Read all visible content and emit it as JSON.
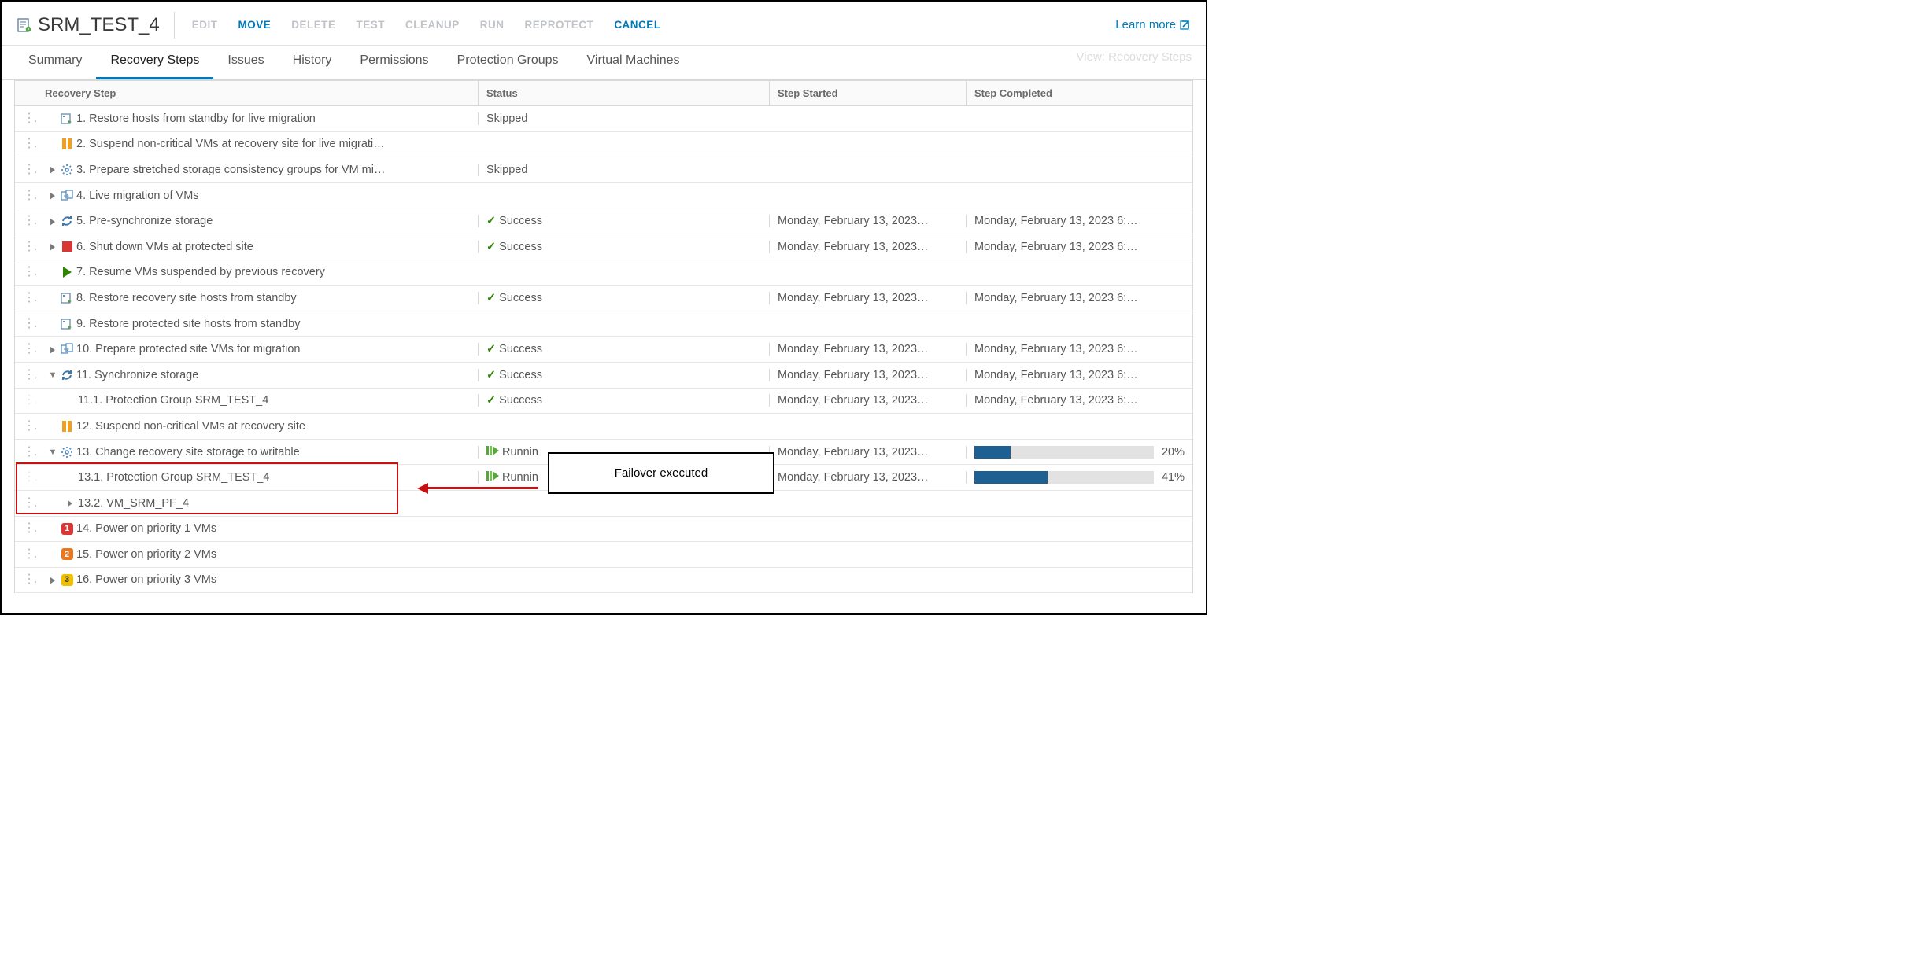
{
  "header": {
    "title": "SRM_TEST_4",
    "actions": [
      {
        "label": "EDIT",
        "enabled": false
      },
      {
        "label": "MOVE",
        "enabled": true
      },
      {
        "label": "DELETE",
        "enabled": false
      },
      {
        "label": "TEST",
        "enabled": false
      },
      {
        "label": "CLEANUP",
        "enabled": false
      },
      {
        "label": "RUN",
        "enabled": false
      },
      {
        "label": "REPROTECT",
        "enabled": false
      },
      {
        "label": "CANCEL",
        "enabled": true
      }
    ],
    "learn_more": "Learn more"
  },
  "tabs": [
    "Summary",
    "Recovery Steps",
    "Issues",
    "History",
    "Permissions",
    "Protection Groups",
    "Virtual Machines"
  ],
  "active_tab": 1,
  "view_hint": "View: Recovery Steps",
  "columns": {
    "step": "Recovery Step",
    "status": "Status",
    "started": "Step Started",
    "completed": "Step Completed"
  },
  "rows": [
    {
      "icon": "host-standby",
      "label": "1. Restore hosts from standby for live migration",
      "status": "Skipped",
      "started": "",
      "completed": "",
      "indent": 0,
      "chev": ""
    },
    {
      "icon": "pause",
      "label": "2. Suspend non-critical VMs at recovery site for live migrati…",
      "status": "",
      "started": "",
      "completed": "",
      "indent": 0,
      "chev": ""
    },
    {
      "icon": "gear",
      "label": "3. Prepare stretched storage consistency groups for VM mi…",
      "status": "Skipped",
      "started": "",
      "completed": "",
      "indent": 0,
      "chev": "right"
    },
    {
      "icon": "migrate",
      "label": "4. Live migration of VMs",
      "status": "",
      "started": "",
      "completed": "",
      "indent": 0,
      "chev": "right"
    },
    {
      "icon": "sync",
      "label": "5. Pre-synchronize storage",
      "status": "success",
      "started": "Monday, February 13, 2023…",
      "completed": "Monday, February 13, 2023 6:…",
      "indent": 0,
      "chev": "right"
    },
    {
      "icon": "stop",
      "label": "6. Shut down VMs at protected site",
      "status": "success",
      "started": "Monday, February 13, 2023…",
      "completed": "Monday, February 13, 2023 6:…",
      "indent": 0,
      "chev": "right"
    },
    {
      "icon": "play",
      "label": "7. Resume VMs suspended by previous recovery",
      "status": "",
      "started": "",
      "completed": "",
      "indent": 0,
      "chev": ""
    },
    {
      "icon": "host-standby",
      "label": "8. Restore recovery site hosts from standby",
      "status": "success",
      "started": "Monday, February 13, 2023…",
      "completed": "Monday, February 13, 2023 6:…",
      "indent": 0,
      "chev": ""
    },
    {
      "icon": "host-standby",
      "label": "9. Restore protected site hosts from standby",
      "status": "",
      "started": "",
      "completed": "",
      "indent": 0,
      "chev": ""
    },
    {
      "icon": "migrate",
      "label": "10. Prepare protected site VMs for migration",
      "status": "success",
      "started": "Monday, February 13, 2023…",
      "completed": "Monday, February 13, 2023 6:…",
      "indent": 0,
      "chev": "right"
    },
    {
      "icon": "sync",
      "label": "11. Synchronize storage",
      "status": "success",
      "started": "Monday, February 13, 2023…",
      "completed": "Monday, February 13, 2023 6:…",
      "indent": 0,
      "chev": "down"
    },
    {
      "icon": "",
      "label": "11.1. Protection Group SRM_TEST_4",
      "status": "success",
      "started": "Monday, February 13, 2023…",
      "completed": "Monday, February 13, 2023 6:…",
      "indent": 1,
      "chev": ""
    },
    {
      "icon": "pause",
      "label": "12. Suspend non-critical VMs at recovery site",
      "status": "",
      "started": "",
      "completed": "",
      "indent": 0,
      "chev": ""
    },
    {
      "icon": "gear",
      "label": "13. Change recovery site storage to writable",
      "status": "running",
      "started": "Monday, February 13, 2023…",
      "completed": "",
      "progress": 20,
      "indent": 0,
      "chev": "down"
    },
    {
      "icon": "",
      "label": "13.1. Protection Group SRM_TEST_4",
      "status": "running",
      "started": "Monday, February 13, 2023…",
      "completed": "",
      "progress": 41,
      "indent": 1,
      "chev": ""
    },
    {
      "icon": "",
      "label": "13.2. VM_SRM_PF_4",
      "status": "",
      "started": "",
      "completed": "",
      "indent": 1,
      "chev": "right"
    },
    {
      "icon": "p1",
      "label": "14. Power on priority 1 VMs",
      "status": "",
      "started": "",
      "completed": "",
      "indent": 0,
      "chev": ""
    },
    {
      "icon": "p2",
      "label": "15. Power on priority 2 VMs",
      "status": "",
      "started": "",
      "completed": "",
      "indent": 0,
      "chev": ""
    },
    {
      "icon": "p3",
      "label": "16. Power on priority 3 VMs",
      "status": "",
      "started": "",
      "completed": "",
      "indent": 0,
      "chev": "right"
    }
  ],
  "status_text": {
    "success": "Success",
    "running": "Runnin",
    "skipped": "Skipped"
  },
  "annotation": {
    "text": "Failover executed"
  }
}
